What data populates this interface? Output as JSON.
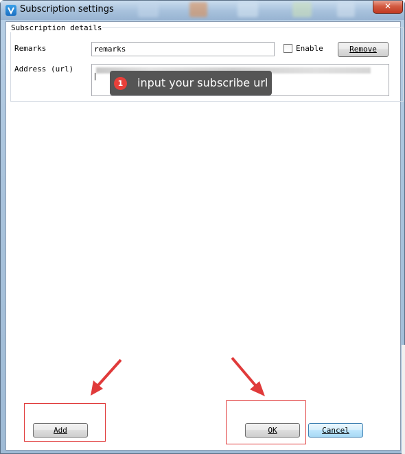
{
  "window": {
    "title": "Subscription settings",
    "close_label": "✕"
  },
  "group": {
    "legend": "Subscription details"
  },
  "form": {
    "remarks_label": "Remarks",
    "remarks_value": "remarks",
    "enable_label": "Enable",
    "remove_label": "Remove",
    "address_label": "Address (url)"
  },
  "annotation": {
    "step_number": "1",
    "tooltip_text": "input your subscribe url",
    "highlight_color": "#e03a3a"
  },
  "buttons": {
    "add_label": "Add",
    "ok_label": "OK",
    "cancel_label": "Cancel"
  }
}
